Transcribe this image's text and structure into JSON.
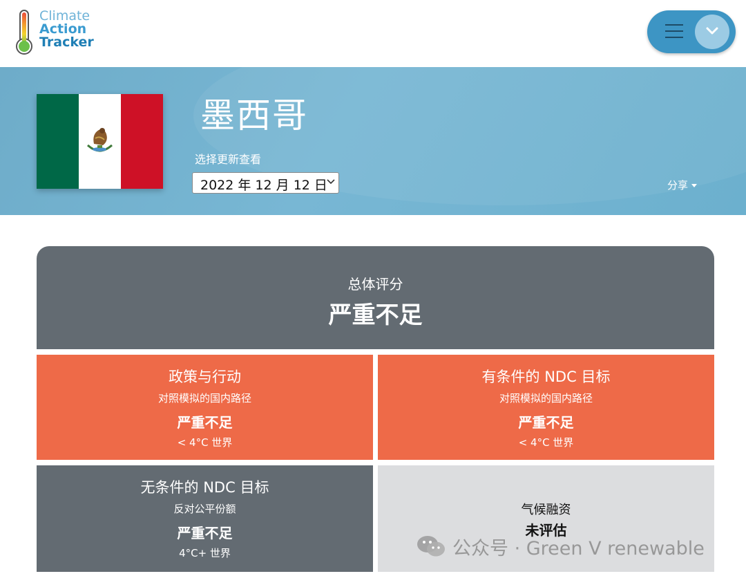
{
  "header": {
    "logo_lines": [
      "Climate",
      "Action",
      "Tracker"
    ],
    "menu_icon": "hamburger-icon",
    "expand_icon": "chevron-down-icon"
  },
  "hero": {
    "country": "墨西哥",
    "select_label": "选择更新查看",
    "selected_date": "2022 年 12 月 12 日",
    "share_label": "分享"
  },
  "overall": {
    "label": "总体评分",
    "rating": "严重不足"
  },
  "tiles": [
    {
      "title": "政策与行动",
      "subtitle": "对照模拟的国内路径",
      "rating": "严重不足",
      "warming": "< 4°C 世界"
    },
    {
      "title": "有条件的 NDC 目标",
      "subtitle": "对照模拟的国内路径",
      "rating": "严重不足",
      "warming": "< 4°C 世界"
    },
    {
      "title": "无条件的 NDC 目标",
      "subtitle": "反对公平份额",
      "rating": "严重不足",
      "warming": "4°C+ 世界"
    },
    {
      "title": "气候融资",
      "rating": "未评估"
    }
  ],
  "watermark": "公众号 · Green V renewable",
  "colors": {
    "hero_bg": "#78b7d4",
    "insufficient_orange": "#ee6a48",
    "slate": "#636b72",
    "not_assessed_grey": "#dcdddf",
    "menu_pill": "#3d95c4"
  }
}
